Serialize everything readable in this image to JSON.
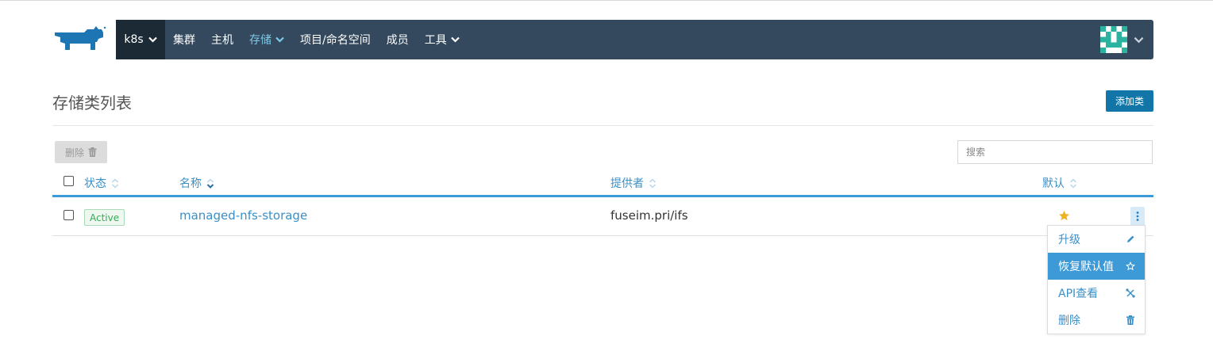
{
  "nav": {
    "environment": "k8s",
    "items": [
      {
        "label": "集群",
        "dropdown": false,
        "active": false
      },
      {
        "label": "主机",
        "dropdown": false,
        "active": false
      },
      {
        "label": "存储",
        "dropdown": true,
        "active": true
      },
      {
        "label": "项目/命名空间",
        "dropdown": false,
        "active": false
      },
      {
        "label": "成员",
        "dropdown": false,
        "active": false
      },
      {
        "label": "工具",
        "dropdown": true,
        "active": false
      }
    ]
  },
  "page": {
    "title": "存储类列表",
    "add_button": "添加类",
    "delete_button": "删除",
    "search_placeholder": "搜索"
  },
  "table": {
    "columns": [
      "状态",
      "名称",
      "提供者",
      "默认"
    ],
    "rows": [
      {
        "state": "Active",
        "name": "managed-nfs-storage",
        "provider": "fuseim.pri/ifs",
        "is_default": true
      }
    ]
  },
  "menu": {
    "items": [
      {
        "label": "升级",
        "icon": "pencil-icon"
      },
      {
        "label": "恢复默认值",
        "icon": "star-outline-icon"
      },
      {
        "label": "API查看",
        "icon": "tools-icon"
      },
      {
        "label": "删除",
        "icon": "trash-icon"
      }
    ]
  },
  "colors": {
    "nav_bg": "#34495e",
    "env_bg": "#1c2a36",
    "accent": "#3a8fc7",
    "primary_button": "#1275a8",
    "active_green": "#3aa95a",
    "star": "#f0b323"
  }
}
